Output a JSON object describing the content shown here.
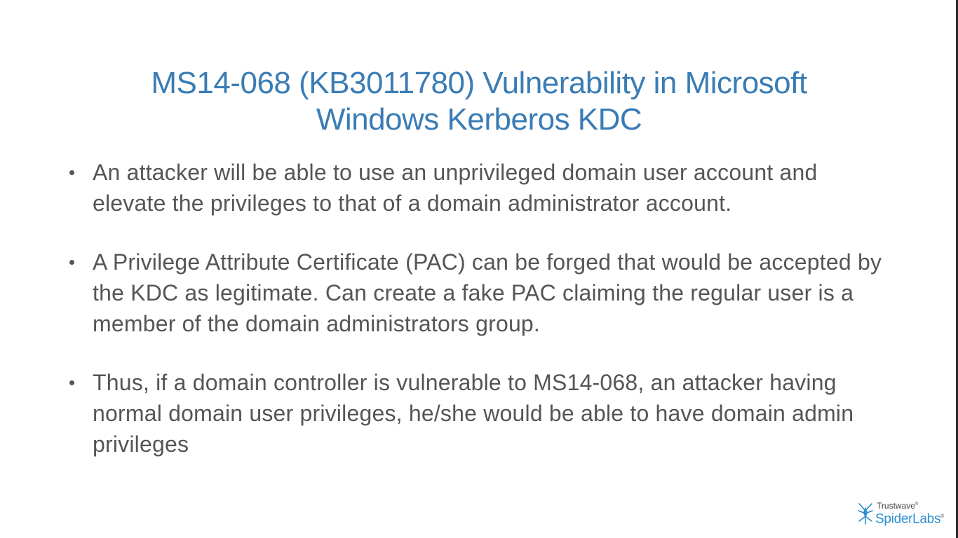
{
  "slide": {
    "title_lines": [
      "MS14-068 (KB3011780) Vulnerability in Microsoft",
      "Windows Kerberos KDC"
    ],
    "bullets": [
      "An attacker will be able to use an unprivileged domain user account and elevate the privileges to that of a domain administrator account.",
      "A Privilege Attribute Certificate (PAC) can be forged that would be accepted by the KDC as legitimate. Can create a fake PAC claiming the regular user is a member of the domain administrators group.",
      "Thus, if a domain controller is vulnerable to MS14-068, an attacker having normal domain user privileges, he/she would be able to have domain admin privileges"
    ]
  },
  "logo": {
    "top_text": "Trustwave",
    "top_mark": "®",
    "bottom_text": "SpiderLabs",
    "bottom_mark": "®",
    "icon": "spider-icon"
  },
  "colors": {
    "title": "#3a7cb5",
    "body_text": "#555555",
    "logo_blue": "#2a8fcf"
  }
}
